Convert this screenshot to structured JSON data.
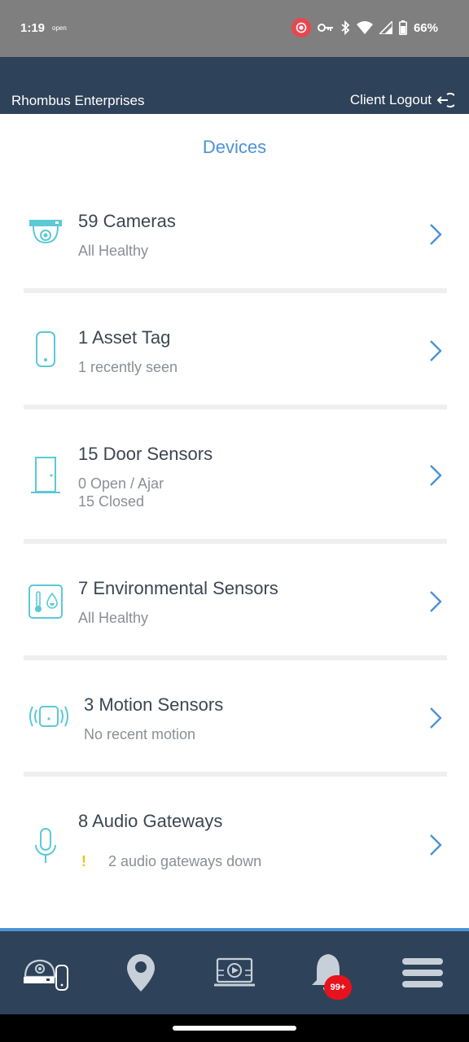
{
  "status_bar": {
    "time": "1:19",
    "open_label": "open",
    "battery": "66%"
  },
  "header": {
    "org_name": "Rhombus Enterprises",
    "logout_label": "Client Logout"
  },
  "page_title": "Devices",
  "devices": [
    {
      "title": "59 Cameras",
      "lines": [
        "All Healthy"
      ],
      "icon": "camera-icon"
    },
    {
      "title": "1 Asset Tag",
      "lines": [
        "1 recently seen"
      ],
      "icon": "asset-tag-icon"
    },
    {
      "title": "15 Door Sensors",
      "lines": [
        "0 Open / Ajar",
        "15 Closed"
      ],
      "icon": "door-icon"
    },
    {
      "title": "7 Environmental Sensors",
      "lines": [
        "All Healthy"
      ],
      "icon": "thermometer-icon"
    },
    {
      "title": "3 Motion Sensors",
      "lines": [
        "No recent motion"
      ],
      "icon": "motion-sensor-icon"
    },
    {
      "title": "8 Audio Gateways",
      "warning_mark": "!",
      "lines": [
        "2 audio gateways down"
      ],
      "icon": "microphone-icon"
    }
  ],
  "bottom_nav": {
    "items": [
      "devices-icon",
      "location-pin-icon",
      "video-wall-icon",
      "bell-icon",
      "hamburger-menu-icon"
    ],
    "notification_badge": "99+"
  },
  "colors": {
    "accent": "#4b92d6",
    "header_bg": "#2e4259",
    "icon_teal": "#5cc9d6",
    "warning": "#f5c400",
    "badge": "#e8121d"
  }
}
